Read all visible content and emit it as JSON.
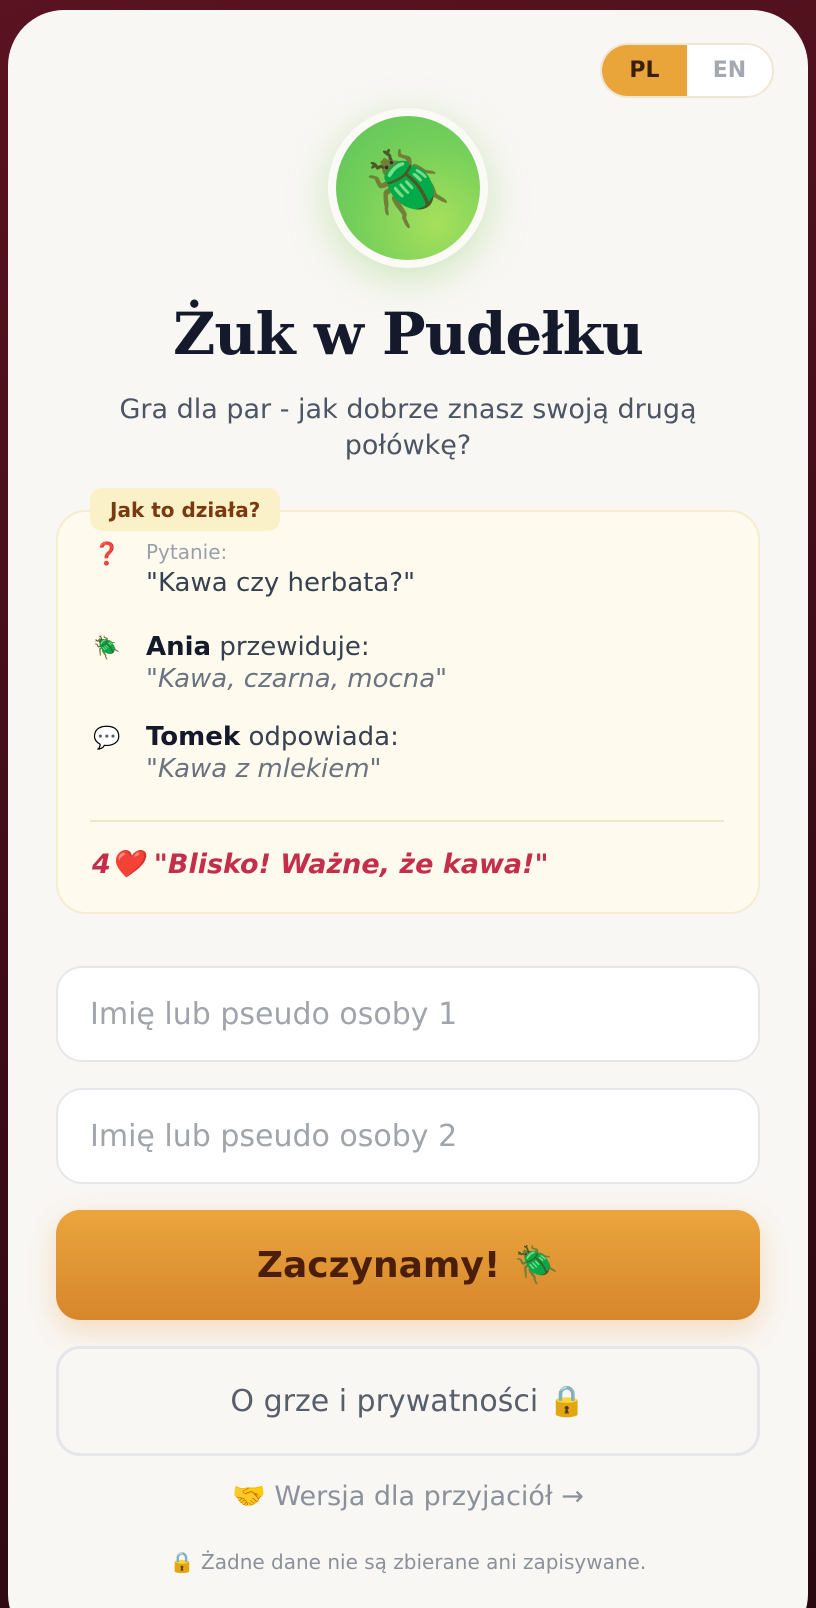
{
  "language_toggle": {
    "options": [
      "PL",
      "EN"
    ],
    "active": "PL"
  },
  "logo": {
    "emoji": "🪲"
  },
  "title": "Żuk w Pudełku",
  "subtitle": "Gra dla par - jak dobrze znasz swoją drugą połówkę?",
  "how_it_works": {
    "tag": "Jak to działa?",
    "question": {
      "icon": "❓",
      "label": "Pytanie:",
      "text": "\"Kawa czy herbata?\""
    },
    "prediction": {
      "icon": "🪲",
      "name": "Ania",
      "verb": "przewiduje:",
      "quote": "\"Kawa, czarna, mocna\""
    },
    "answer": {
      "icon": "💬",
      "name": "Tomek",
      "verb": "odpowiada:",
      "quote": "\"Kawa z mlekiem\""
    },
    "score": "4❤️ \"Blisko! Ważne, że kawa!\""
  },
  "inputs": {
    "player1_placeholder": "Imię lub pseudo osoby 1",
    "player1_value": "",
    "player2_placeholder": "Imię lub pseudo osoby 2",
    "player2_value": ""
  },
  "start_button": {
    "label": "Zaczynamy!",
    "icon": "🪲"
  },
  "about_button": {
    "label": "O grze i prywatności",
    "icon": "🔒"
  },
  "friends_link": "🤝 Wersja dla przyjaciół →",
  "privacy_note": "🔒 Żadne dane nie są zbierane ani zapisywane.",
  "colors": {
    "accent": "#e9a43a",
    "background_dark": "#4a0f1b",
    "card": "#f9f7f4",
    "score_red": "#c52e4a"
  }
}
